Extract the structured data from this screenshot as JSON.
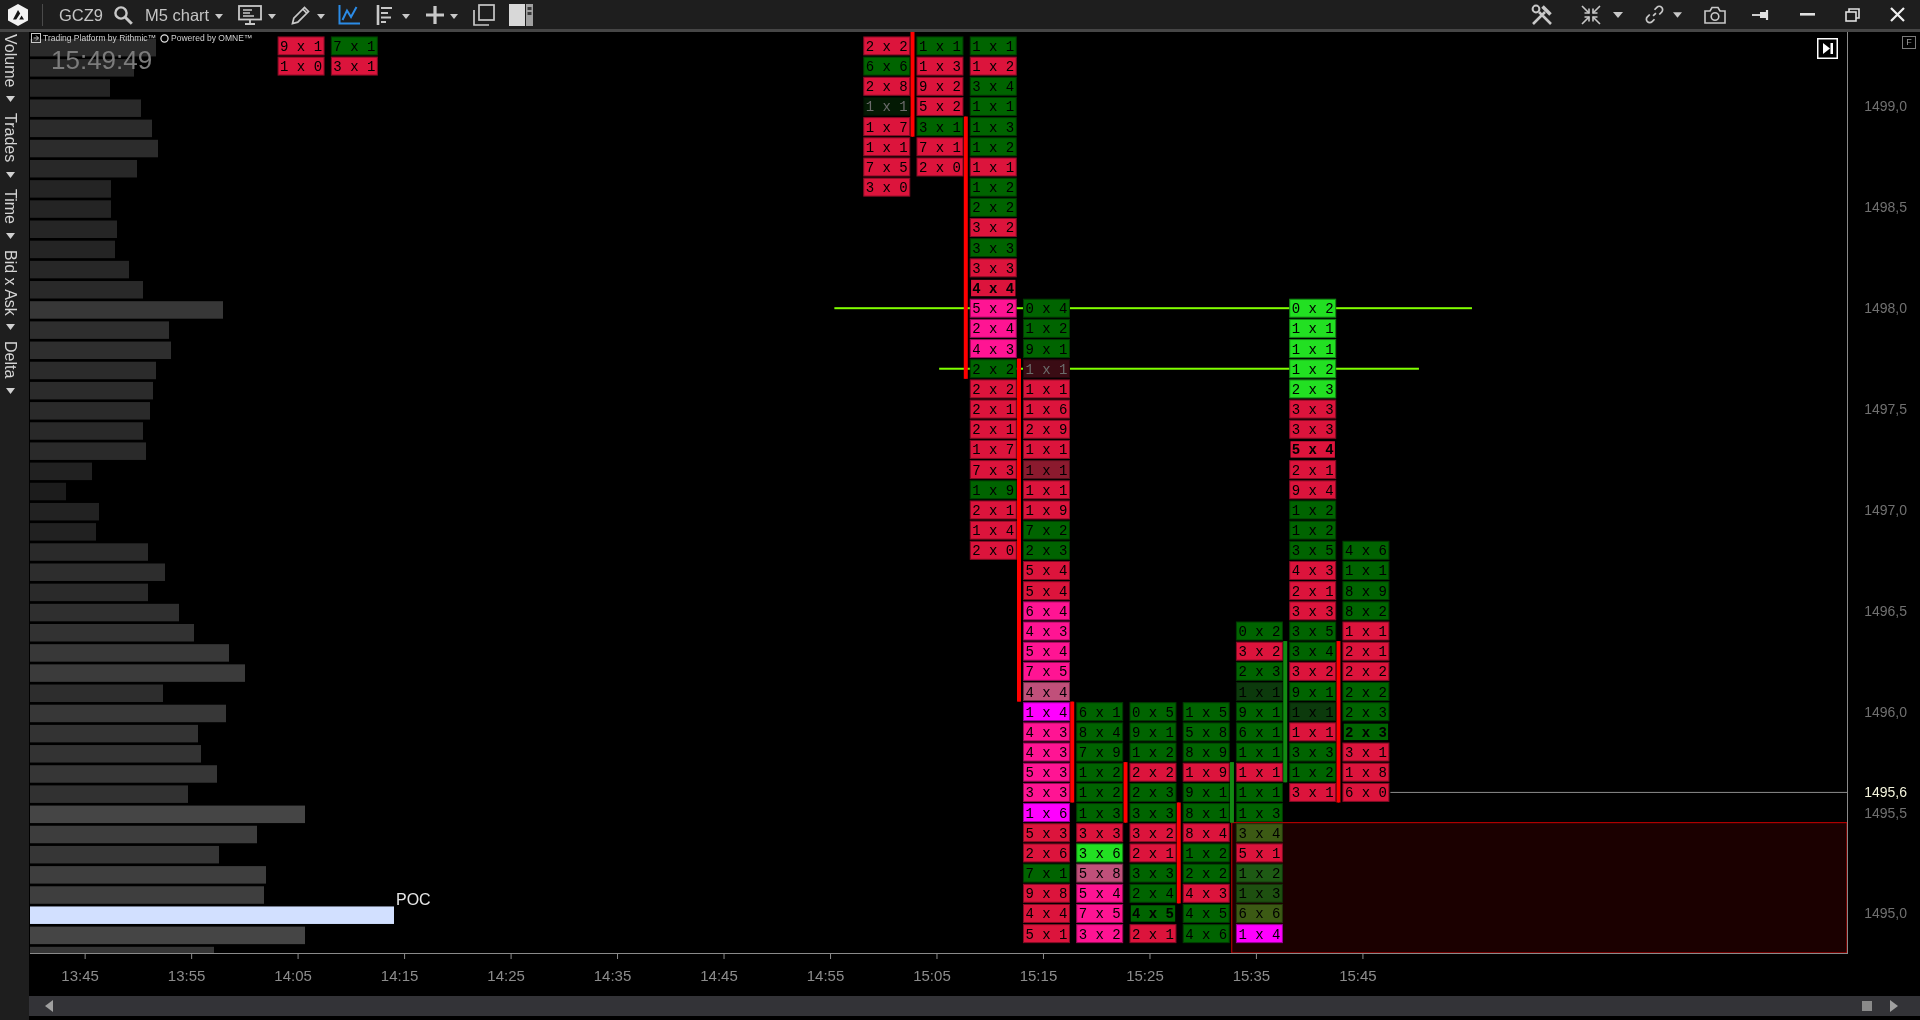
{
  "toolbar": {
    "symbol": "GCZ9",
    "chart_type": "M5 chart"
  },
  "side_panel": {
    "items": [
      {
        "label": "Volume"
      },
      {
        "label": "Trades"
      },
      {
        "label": "Time"
      },
      {
        "label": "Bid x Ask"
      },
      {
        "label": "Delta"
      }
    ]
  },
  "chart": {
    "branding": [
      "Trading Platform by Rithmic™",
      "Powered by OMNE™"
    ],
    "clock": "15:49:49",
    "scale_button": "F",
    "poc_label": "POC",
    "chart_data": [
      {
        "type": "candlestick",
        "x": [
          15.0403,
          15.1237,
          15.207,
          15.2903,
          15.3737,
          15.457,
          15.5403,
          15.6237,
          15.707
        ],
        "ohlc": [
          [
            1499.37,
            1499.37,
            1498.85,
            1498.85
          ],
          [
            1498.95,
            1498.95,
            1497.65,
            1497.65
          ],
          [
            1497.75,
            1497.75,
            1496.05,
            1496.05
          ],
          [
            1496.05,
            1496.05,
            1495.55,
            1495.55
          ],
          [
            1495.75,
            1495.75,
            1495.45,
            1495.45
          ],
          [
            1495.55,
            1495.55,
            1495.05,
            1495.05
          ],
          [
            1495.45,
            1495.75,
            1495.45,
            1495.75
          ],
          [
            1495.65,
            1496.35,
            1495.65,
            1496.35
          ],
          [
            1496.35,
            1496.35,
            1495.55,
            1495.55
          ]
        ],
        "xlim": [
          13.659,
          16.503
        ],
        "ylim": [
          1494.804,
          1499.369
        ],
        "xticks": [
          {
            "value": 13.75,
            "label": "13:45"
          },
          {
            "value": 13.9167,
            "label": "13:55"
          },
          {
            "value": 14.0833,
            "label": "14:05"
          },
          {
            "value": 14.25,
            "label": "14:15"
          },
          {
            "value": 14.4167,
            "label": "14:25"
          },
          {
            "value": 14.5833,
            "label": "14:35"
          },
          {
            "value": 14.75,
            "label": "14:45"
          },
          {
            "value": 14.9167,
            "label": "14:55"
          },
          {
            "value": 15.0833,
            "label": "15:05"
          },
          {
            "value": 15.25,
            "label": "15:15"
          },
          {
            "value": 15.4167,
            "label": "15:25"
          },
          {
            "value": 15.5833,
            "label": "15:35"
          },
          {
            "value": 15.75,
            "label": "15:45"
          }
        ],
        "yticks": [
          {
            "value": 1499.0,
            "label": "1499,0"
          },
          {
            "value": 1498.5,
            "label": "1498,5"
          },
          {
            "value": 1498.0,
            "label": "1498,0"
          },
          {
            "value": 1497.5,
            "label": "1497,5"
          },
          {
            "value": 1497.0,
            "label": "1497,0"
          },
          {
            "value": 1496.5,
            "label": "1496,5"
          },
          {
            "value": 1496.0,
            "label": "1496,0"
          },
          {
            "value": 1495.5,
            "label": "1495,5"
          },
          {
            "value": 1495.0,
            "label": "1495,0"
          }
        ],
        "ref_lines": [
          {
            "axis": "y",
            "value": 1498.0,
            "color": "#80ff00"
          },
          {
            "axis": "y",
            "value": 1497.7,
            "color": "#80ff00"
          },
          {
            "axis": "y",
            "value": 1495.6,
            "label": "1495,6",
            "color": "#8c8c8c"
          }
        ],
        "bands": [
          {
            "axis": "y",
            "from": 1494.804,
            "to": 1495.45,
            "color": "#cc0000"
          }
        ]
      }
    ],
    "footprint": {
      "columns": [
        {
          "cells": [
            {
              "text": "9 x 1",
              "color": "#dc143c",
              "poc": false
            },
            {
              "text": "1 x 0",
              "color": "#dc143c",
              "poc": false
            }
          ]
        },
        {
          "cells": [
            {
              "text": "7 x 1",
              "color": "#006400",
              "poc": false
            },
            {
              "text": "3 x 1",
              "color": "#dc143c",
              "poc": false
            }
          ]
        },
        {
          "cells": [
            {
              "text": "2 x 2",
              "color": "#dc143c",
              "poc": false
            },
            {
              "text": "6 x 6",
              "color": "#006400",
              "poc": false
            },
            {
              "text": "2 x 8",
              "color": "#dc143c",
              "poc": false
            },
            {
              "text": "1 x 1",
              "color": "#041a04",
              "poc": false
            },
            {
              "text": "1 x 7",
              "color": "#dc143c",
              "poc": false
            },
            {
              "text": "1 x 1",
              "color": "#dc143c",
              "poc": false
            },
            {
              "text": "7 x 5",
              "color": "#dc143c",
              "poc": false
            },
            {
              "text": "3 x 0",
              "color": "#dc143c",
              "poc": false
            }
          ]
        },
        {
          "cells": [
            {
              "text": "1 x 1",
              "color": "#006400",
              "poc": false
            },
            {
              "text": "1 x 3",
              "color": "#dc143c",
              "poc": false
            },
            {
              "text": "9 x 2",
              "color": "#dc143c",
              "poc": false
            },
            {
              "text": "5 x 2",
              "color": "#dc143c",
              "poc": false
            },
            {
              "text": "3 x 1",
              "color": "#006400",
              "poc": false
            },
            {
              "text": "7 x 1",
              "color": "#dc143c",
              "poc": false
            },
            {
              "text": "2 x 0",
              "color": "#dc143c",
              "poc": false
            }
          ]
        },
        {
          "cells": [
            {
              "text": "1 x 1",
              "color": "#006400",
              "poc": false
            },
            {
              "text": "1 x 2",
              "color": "#dc143c",
              "poc": false
            },
            {
              "text": "3 x 4",
              "color": "#006400",
              "poc": false
            },
            {
              "text": "1 x 1",
              "color": "#006400",
              "poc": false
            },
            {
              "text": "1 x 3",
              "color": "#006400",
              "poc": false
            },
            {
              "text": "1 x 2",
              "color": "#006400",
              "poc": false
            },
            {
              "text": "1 x 1",
              "color": "#dc143c",
              "poc": false
            },
            {
              "text": "1 x 2",
              "color": "#006400",
              "poc": false
            },
            {
              "text": "2 x 2",
              "color": "#006400",
              "poc": false
            },
            {
              "text": "3 x 2",
              "color": "#dc143c",
              "poc": false
            },
            {
              "text": "3 x 3",
              "color": "#006400",
              "poc": false
            },
            {
              "text": "3 x 3",
              "color": "#dc143c",
              "poc": false
            },
            {
              "text": "4 x 4",
              "color": "#dc143c",
              "poc": true
            },
            {
              "text": "5 x 2",
              "color": "#ff1493",
              "poc": false
            },
            {
              "text": "2 x 4",
              "color": "#ff1493",
              "poc": false
            },
            {
              "text": "4 x 3",
              "color": "#ff1493",
              "poc": false
            },
            {
              "text": "2 x 2",
              "color": "#006400",
              "poc": false
            },
            {
              "text": "2 x 2",
              "color": "#dc143c",
              "poc": false
            },
            {
              "text": "2 x 1",
              "color": "#dc143c",
              "poc": false
            },
            {
              "text": "2 x 1",
              "color": "#dc143c",
              "poc": false
            },
            {
              "text": "1 x 7",
              "color": "#dc143c",
              "poc": false
            },
            {
              "text": "7 x 3",
              "color": "#dc143c",
              "poc": false
            },
            {
              "text": "1 x 9",
              "color": "#006400",
              "poc": false
            },
            {
              "text": "2 x 1",
              "color": "#dc143c",
              "poc": false
            },
            {
              "text": "1 x 4",
              "color": "#dc143c",
              "poc": false
            },
            {
              "text": "2 x 0",
              "color": "#dc143c",
              "poc": false
            }
          ]
        },
        {
          "cells": [
            {
              "text": "0 x 4",
              "color": "#006400",
              "poc": false
            },
            {
              "text": "1 x 2",
              "color": "#006400",
              "poc": false
            },
            {
              "text": "9 x 1",
              "color": "#006400",
              "poc": false
            },
            {
              "text": "1 x 1",
              "color": "#3a0c14",
              "poc": false
            },
            {
              "text": "1 x 1",
              "color": "#dc143c",
              "poc": false
            },
            {
              "text": "1 x 6",
              "color": "#dc143c",
              "poc": false
            },
            {
              "text": "2 x 9",
              "color": "#dc143c",
              "poc": false
            },
            {
              "text": "1 x 1",
              "color": "#dc143c",
              "poc": false
            },
            {
              "text": "1 x 1",
              "color": "#8b1a2e",
              "poc": false
            },
            {
              "text": "1 x 1",
              "color": "#dc143c",
              "poc": false
            },
            {
              "text": "1 x 9",
              "color": "#dc143c",
              "poc": false
            },
            {
              "text": "7 x 2",
              "color": "#006400",
              "poc": false
            },
            {
              "text": "2 x 3",
              "color": "#006400",
              "poc": false
            },
            {
              "text": "5 x 4",
              "color": "#dc143c",
              "poc": false
            },
            {
              "text": "5 x 4",
              "color": "#dc143c",
              "poc": false
            },
            {
              "text": "6 x 4",
              "color": "#ff1493",
              "poc": false
            },
            {
              "text": "4 x 3",
              "color": "#ff1493",
              "poc": false
            },
            {
              "text": "5 x 4",
              "color": "#ff1493",
              "poc": false
            },
            {
              "text": "7 x 5",
              "color": "#ff1493",
              "poc": false
            },
            {
              "text": "4 x 4",
              "color": "#c0507a",
              "poc": false
            },
            {
              "text": "1 x 4",
              "color": "#ff00ff",
              "poc": false
            },
            {
              "text": "4 x 3",
              "color": "#ff1493",
              "poc": false
            },
            {
              "text": "4 x 3",
              "color": "#ff1493",
              "poc": false
            },
            {
              "text": "5 x 3",
              "color": "#ff1493",
              "poc": false
            },
            {
              "text": "3 x 3",
              "color": "#ff1493",
              "poc": false
            },
            {
              "text": "1 x 6",
              "color": "#ff00ff",
              "poc": false
            },
            {
              "text": "5 x 3",
              "color": "#dc143c",
              "poc": false
            },
            {
              "text": "2 x 6",
              "color": "#dc143c",
              "poc": false
            },
            {
              "text": "7 x 1",
              "color": "#006400",
              "poc": false
            },
            {
              "text": "9 x 8",
              "color": "#dc143c",
              "poc": false
            },
            {
              "text": "4 x 4",
              "color": "#dc143c",
              "poc": false
            },
            {
              "text": "5 x 1",
              "color": "#dc143c",
              "poc": false
            }
          ]
        },
        {
          "cells": [
            {
              "text": "6 x 1",
              "color": "#006400",
              "poc": false
            },
            {
              "text": "8 x 4",
              "color": "#006400",
              "poc": false
            },
            {
              "text": "7 x 9",
              "color": "#006400",
              "poc": false
            },
            {
              "text": "1 x 2",
              "color": "#006400",
              "poc": false
            },
            {
              "text": "1 x 2",
              "color": "#006400",
              "poc": false
            },
            {
              "text": "1 x 3",
              "color": "#006400",
              "poc": false
            },
            {
              "text": "3 x 3",
              "color": "#dc143c",
              "poc": false
            },
            {
              "text": "3 x 6",
              "color": "#22e022",
              "poc": false
            },
            {
              "text": "5 x 8",
              "color": "#c0507a",
              "poc": false
            },
            {
              "text": "5 x 4",
              "color": "#ff1493",
              "poc": false
            },
            {
              "text": "7 x 5",
              "color": "#ff1493",
              "poc": false
            },
            {
              "text": "3 x 2",
              "color": "#ff1493",
              "poc": false
            }
          ]
        },
        {
          "cells": [
            {
              "text": "0 x 5",
              "color": "#006400",
              "poc": false
            },
            {
              "text": "9 x 1",
              "color": "#006400",
              "poc": false
            },
            {
              "text": "1 x 2",
              "color": "#006400",
              "poc": false
            },
            {
              "text": "2 x 2",
              "color": "#dc143c",
              "poc": false
            },
            {
              "text": "2 x 3",
              "color": "#006400",
              "poc": false
            },
            {
              "text": "3 x 3",
              "color": "#006400",
              "poc": false
            },
            {
              "text": "3 x 2",
              "color": "#dc143c",
              "poc": false
            },
            {
              "text": "2 x 1",
              "color": "#dc143c",
              "poc": false
            },
            {
              "text": "3 x 3",
              "color": "#006400",
              "poc": false
            },
            {
              "text": "2 x 4",
              "color": "#006400",
              "poc": false
            },
            {
              "text": "4 x 5",
              "color": "#006400",
              "poc": true
            },
            {
              "text": "2 x 1",
              "color": "#dc143c",
              "poc": false
            }
          ]
        },
        {
          "cells": [
            {
              "text": "1 x 5",
              "color": "#006400",
              "poc": false
            },
            {
              "text": "5 x 8",
              "color": "#006400",
              "poc": false
            },
            {
              "text": "8 x 9",
              "color": "#006400",
              "poc": false
            },
            {
              "text": "1 x 9",
              "color": "#dc143c",
              "poc": false
            },
            {
              "text": "9 x 1",
              "color": "#006400",
              "poc": false
            },
            {
              "text": "8 x 1",
              "color": "#006400",
              "poc": false
            },
            {
              "text": "8 x 4",
              "color": "#dc143c",
              "poc": false
            },
            {
              "text": "1 x 2",
              "color": "#006400",
              "poc": false
            },
            {
              "text": "2 x 2",
              "color": "#006400",
              "poc": false
            },
            {
              "text": "4 x 3",
              "color": "#dc143c",
              "poc": false
            },
            {
              "text": "4 x 5",
              "color": "#006400",
              "poc": false
            },
            {
              "text": "4 x 6",
              "color": "#006400",
              "poc": false
            }
          ]
        },
        {
          "cells": [
            {
              "text": "0 x 2",
              "color": "#006400",
              "poc": false
            },
            {
              "text": "3 x 2",
              "color": "#dc143c",
              "poc": false
            },
            {
              "text": "2 x 3",
              "color": "#006400",
              "poc": false
            },
            {
              "text": "1 x 1",
              "color": "#0c3a0c",
              "poc": false
            },
            {
              "text": "9 x 1",
              "color": "#006400",
              "poc": false
            },
            {
              "text": "6 x 1",
              "color": "#006400",
              "poc": false
            },
            {
              "text": "1 x 1",
              "color": "#006400",
              "poc": false
            },
            {
              "text": "1 x 1",
              "color": "#dc143c",
              "poc": false
            },
            {
              "text": "1 x 1",
              "color": "#006400",
              "poc": false
            },
            {
              "text": "1 x 3",
              "color": "#006400",
              "poc": false
            },
            {
              "text": "3 x 4",
              "color": "#3c5a14",
              "poc": false
            },
            {
              "text": "5 x 1",
              "color": "#dc143c",
              "poc": false
            },
            {
              "text": "1 x 2",
              "color": "#1e5a14",
              "poc": false
            },
            {
              "text": "1 x 3",
              "color": "#1e5010",
              "poc": false
            },
            {
              "text": "6 x 6",
              "color": "#3c5a14",
              "poc": false
            },
            {
              "text": "1 x 4",
              "color": "#ff00ff",
              "poc": false
            }
          ]
        },
        {
          "cells": [
            {
              "text": "0 x 2",
              "color": "#22e022",
              "poc": false
            },
            {
              "text": "1 x 1",
              "color": "#22e022",
              "poc": false
            },
            {
              "text": "1 x 1",
              "color": "#22e022",
              "poc": false
            },
            {
              "text": "1 x 2",
              "color": "#22e022",
              "poc": false
            },
            {
              "text": "2 x 3",
              "color": "#22e022",
              "poc": false
            },
            {
              "text": "3 x 3",
              "color": "#dc143c",
              "poc": false
            },
            {
              "text": "3 x 3",
              "color": "#dc143c",
              "poc": false
            },
            {
              "text": "5 x 4",
              "color": "#dc143c",
              "poc": true
            },
            {
              "text": "2 x 1",
              "color": "#dc143c",
              "poc": false
            },
            {
              "text": "9 x 4",
              "color": "#dc143c",
              "poc": false
            },
            {
              "text": "1 x 2",
              "color": "#006400",
              "poc": false
            },
            {
              "text": "1 x 2",
              "color": "#006400",
              "poc": false
            },
            {
              "text": "3 x 5",
              "color": "#006400",
              "poc": false
            },
            {
              "text": "4 x 3",
              "color": "#dc143c",
              "poc": false
            },
            {
              "text": "2 x 1",
              "color": "#dc143c",
              "poc": false
            },
            {
              "text": "3 x 3",
              "color": "#dc143c",
              "poc": false
            },
            {
              "text": "3 x 5",
              "color": "#006400",
              "poc": false
            },
            {
              "text": "3 x 4",
              "color": "#006400",
              "poc": false
            },
            {
              "text": "3 x 2",
              "color": "#dc143c",
              "poc": false
            },
            {
              "text": "9 x 1",
              "color": "#006400",
              "poc": false
            },
            {
              "text": "1 x 1",
              "color": "#0c3a0c",
              "poc": false
            },
            {
              "text": "1 x 1",
              "color": "#dc143c",
              "poc": false
            },
            {
              "text": "3 x 3",
              "color": "#006400",
              "poc": false
            },
            {
              "text": "1 x 2",
              "color": "#006400",
              "poc": false
            },
            {
              "text": "3 x 1",
              "color": "#dc143c",
              "poc": false
            }
          ]
        },
        {
          "cells": [
            {
              "text": "4 x 6",
              "color": "#006400",
              "poc": false
            },
            {
              "text": "1 x 1",
              "color": "#006400",
              "poc": false
            },
            {
              "text": "8 x 9",
              "color": "#006400",
              "poc": false
            },
            {
              "text": "8 x 2",
              "color": "#006400",
              "poc": false
            },
            {
              "text": "1 x 1",
              "color": "#dc143c",
              "poc": false
            },
            {
              "text": "2 x 1",
              "color": "#dc143c",
              "poc": false
            },
            {
              "text": "2 x 2",
              "color": "#dc143c",
              "poc": false
            },
            {
              "text": "2 x 2",
              "color": "#006400",
              "poc": false
            },
            {
              "text": "2 x 3",
              "color": "#006400",
              "poc": false
            },
            {
              "text": "2 x 3",
              "color": "#006400",
              "poc": true
            },
            {
              "text": "3 x 1",
              "color": "#dc143c",
              "poc": false
            },
            {
              "text": "1 x 8",
              "color": "#dc143c",
              "poc": false
            },
            {
              "text": "6 x 0",
              "color": "#dc143c",
              "poc": false
            }
          ]
        }
      ]
    }
  }
}
